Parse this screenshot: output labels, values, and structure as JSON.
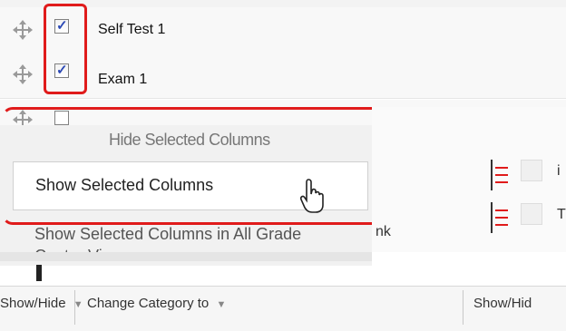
{
  "rows": [
    {
      "label": "Self Test 1",
      "checked": true
    },
    {
      "label": "Exam 1",
      "checked": true
    },
    {
      "label": "",
      "checked": false
    }
  ],
  "context_menu": {
    "items": [
      {
        "label": "Hide Selected Columns"
      },
      {
        "label": "Show Selected Columns",
        "highlighted": true
      },
      {
        "label": "Show Selected Columns in All Grade Center Views"
      }
    ]
  },
  "right_column": {
    "fragment_1": "i",
    "fragment_2": "T",
    "fragment_link": "nk"
  },
  "toolbar": {
    "show_hide_label": "Show/Hide",
    "change_category_label": "Change Category to",
    "show_hide_users_label": "Show/Hid"
  },
  "colors": {
    "highlight_red": "#e01b1b",
    "checkbox_tick": "#2b48b5"
  }
}
